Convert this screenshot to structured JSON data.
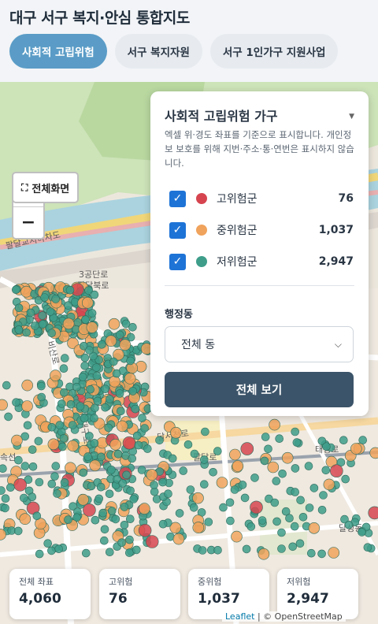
{
  "app": {
    "title": "대구 서구 복지·안심 통합지도"
  },
  "tabs": [
    {
      "label": "사회적 고립위험",
      "active": true
    },
    {
      "label": "서구 복지자원",
      "active": false
    },
    {
      "label": "서구 1인가구 지원사업",
      "active": false
    }
  ],
  "map": {
    "zoom_in": "+",
    "zoom_out": "−",
    "fullscreen_icon": "fullscreen-icon",
    "fullscreen_label": "전체화면",
    "place_labels": [
      "팔달교지하차도",
      "3공단로",
      "팔달북로",
      "공단",
      "비산로",
      "당산",
      "달서천로",
      "서대구로63길",
      "팔달로",
      "경부선",
      "속선",
      "달성동",
      "태평로",
      "달서천로"
    ]
  },
  "panel": {
    "title": "사회적 고립위험 가구",
    "desc": "엑셀 위·경도 좌표를 기준으로 표시합니다. 개인정보 보호를 위해 지번·주소·통·연번은 표시하지 않습니다.",
    "legend": [
      {
        "label": "고위험군",
        "count": "76",
        "color": "#d6454f",
        "checked": true
      },
      {
        "label": "중위험군",
        "count": "1,037",
        "color": "#f0a35c",
        "checked": true
      },
      {
        "label": "저위험군",
        "count": "2,947",
        "color": "#3e9e8a",
        "checked": true
      }
    ],
    "dong_label": "행정동",
    "dong_selected": "전체 동",
    "show_all": "전체 보기"
  },
  "stats": [
    {
      "label": "전체 좌표",
      "value": "4,060"
    },
    {
      "label": "고위험",
      "value": "76"
    },
    {
      "label": "중위험",
      "value": "1,037"
    },
    {
      "label": "저위험",
      "value": "2,947"
    }
  ],
  "attribution": {
    "leaflet": "Leaflet",
    "osm": "OpenStreetMap"
  }
}
